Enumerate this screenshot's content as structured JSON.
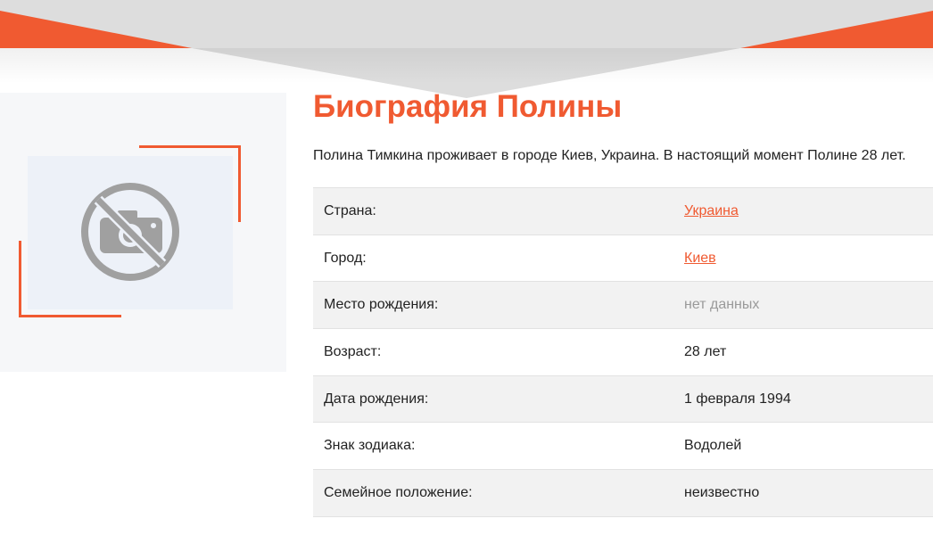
{
  "colors": {
    "accent": "#f05a31",
    "header_gray": "#dddddd",
    "row_shade": "#f2f2f2",
    "muted_text": "#9a9a9a"
  },
  "photo": {
    "icon": "no-photo-icon"
  },
  "bio": {
    "title": "Биография Полины",
    "intro": "Полина Тимкина проживает в городе Киев, Украина. В настоящий момент Полине 28 лет.",
    "rows": [
      {
        "label": "Страна:",
        "value": "Украина",
        "style": "link"
      },
      {
        "label": "Город:",
        "value": "Киев",
        "style": "link"
      },
      {
        "label": "Место рождения:",
        "value": "нет данных",
        "style": "muted"
      },
      {
        "label": "Возраст:",
        "value": "28 лет",
        "style": "plain"
      },
      {
        "label": "Дата рождения:",
        "value": "1 февраля 1994",
        "style": "plain"
      },
      {
        "label": "Знак зодиака:",
        "value": "Водолей",
        "style": "plain"
      },
      {
        "label": "Семейное положение:",
        "value": "неизвестно",
        "style": "plain"
      }
    ]
  }
}
